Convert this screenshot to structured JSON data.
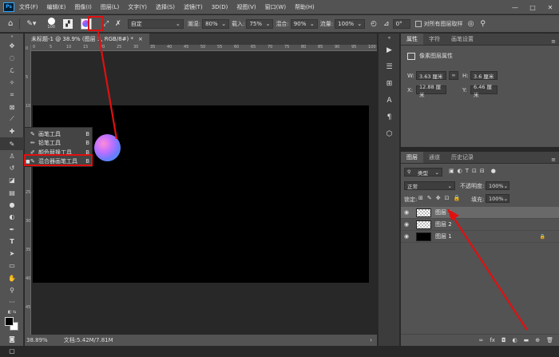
{
  "menubar": {
    "logo": "Ps",
    "items": [
      "文件(F)",
      "编辑(E)",
      "图像(I)",
      "图层(L)",
      "文字(Y)",
      "选择(S)",
      "滤镜(T)",
      "3D(D)",
      "视图(V)",
      "窗口(W)",
      "帮助(H)"
    ],
    "window_buttons": [
      "—",
      "□",
      "✕"
    ]
  },
  "options_bar": {
    "brush_size": "100",
    "preset": "自定",
    "wet_label": "潮湿:",
    "wet_value": "80%",
    "load_label": "载入:",
    "load_value": "75%",
    "mix_label": "混合:",
    "mix_value": "90%",
    "flow_label": "流量:",
    "flow_value": "100%",
    "angle_value": "0°",
    "sample_all_label": "对所有图层取样"
  },
  "document": {
    "tab_title": "未标题-1 @ 38.9% (图层 3, RGB/8#) *",
    "close": "×",
    "ruler_ticks": [
      "0",
      "5",
      "10",
      "15",
      "20",
      "25",
      "30",
      "35",
      "40",
      "45",
      "50",
      "55",
      "60",
      "65",
      "70",
      "75",
      "80",
      "85",
      "90",
      "95",
      "100"
    ],
    "ruler_left_ticks": [
      "0",
      "5",
      "10",
      "15",
      "20",
      "25",
      "30",
      "35",
      "40",
      "45"
    ]
  },
  "status_bar": {
    "zoom": "38.89%",
    "doc_info": "文档:5.42M/7.81M"
  },
  "tool_flyout": {
    "items": [
      {
        "marker": "",
        "label": "画笔工具",
        "shortcut": "B"
      },
      {
        "marker": "",
        "label": "铅笔工具",
        "shortcut": "B"
      },
      {
        "marker": "",
        "label": "颜色替换工具",
        "shortcut": "B"
      },
      {
        "marker": "■",
        "label": "混合器画笔工具",
        "shortcut": "B"
      }
    ]
  },
  "properties_panel": {
    "tabs": [
      "属性",
      "字符",
      "画笔设置"
    ],
    "subtitle": "像素图层属性",
    "w_label": "W:",
    "w_value": "3.63 厘米",
    "h_label": "H:",
    "h_value": "3.6 厘米",
    "x_label": "X:",
    "x_value": "12.88 厘米",
    "y_label": "Y:",
    "y_value": "6.46 厘米"
  },
  "layers_panel": {
    "tabs": [
      "图层",
      "通道",
      "历史记录"
    ],
    "filter_kind": "类型",
    "blend_mode": "正常",
    "opacity_label": "不透明度:",
    "opacity_value": "100%",
    "lock_label": "锁定:",
    "fill_label": "填充:",
    "fill_value": "100%",
    "layers": [
      {
        "name": "图层 3",
        "selected": true
      },
      {
        "name": "图层 2",
        "selected": false
      },
      {
        "name": "图层 1",
        "selected": false
      }
    ]
  },
  "colors": {
    "accent_red": "#e01010",
    "panel_bg": "#535353",
    "canvas_bg": "#000000"
  }
}
